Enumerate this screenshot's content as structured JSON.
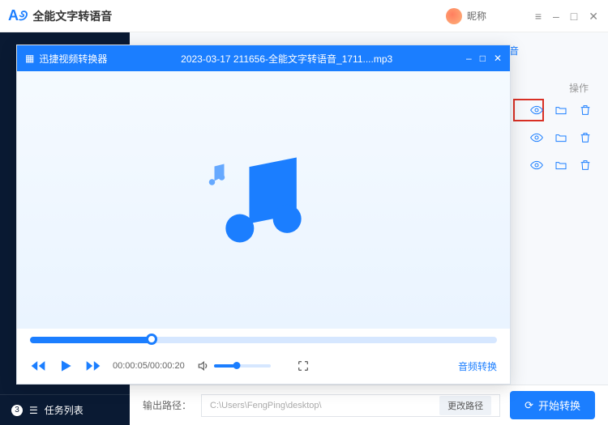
{
  "titlebar": {
    "app_name": "全能文字转语音",
    "nickname_label": "昵称"
  },
  "sidebar": {
    "task_list_label": "任务列表",
    "task_count": "3"
  },
  "table": {
    "col_operations": "操作",
    "truncated_header": "音"
  },
  "bottom": {
    "output_label": "输出路径：",
    "output_path": "C:\\Users\\FengPing\\desktop\\",
    "change_path": "更改路径",
    "start_convert": "开始转换"
  },
  "player": {
    "app_name": "迅捷视频转换器",
    "file_title": "2023-03-17 211656-全能文字转语音_1711....mp3",
    "time_display": "00:00:05/00:00:20",
    "convert_label": "音频转换"
  }
}
